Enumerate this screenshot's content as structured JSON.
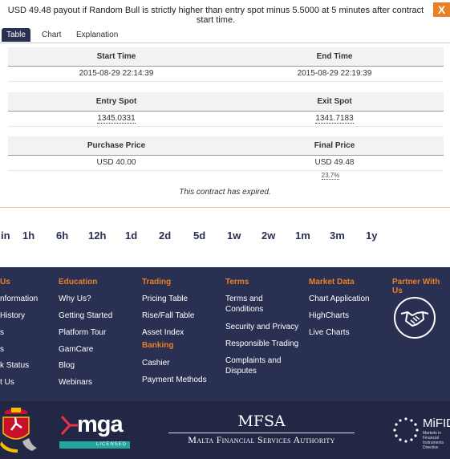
{
  "dialog": {
    "title": "USD 49.48 payout if Random Bull is strictly higher than entry spot minus 5.5000 at 5 minutes after contract start time.",
    "close_label": "X",
    "tabs": [
      "Table",
      "Chart",
      "Explanation"
    ],
    "active_tab": "Table",
    "rows": {
      "start_time_label": "Start Time",
      "start_time_value": "2015-08-29 22:14:39",
      "end_time_label": "End Time",
      "end_time_value": "2015-08-29 22:19:39",
      "entry_spot_label": "Entry Spot",
      "entry_spot_value": "1345.0331",
      "exit_spot_label": "Exit Spot",
      "exit_spot_value": "1341.7183",
      "purchase_price_label": "Purchase Price",
      "purchase_price_value": "USD 40.00",
      "final_price_label": "Final Price",
      "final_price_value": "USD 49.48",
      "profit_percent": "23.7%"
    },
    "expired_message": "This contract has expired.",
    "accent_color": "#e98024",
    "tab_active_color": "#2a3052"
  },
  "timeframes": [
    "in",
    "1h",
    "6h",
    "12h",
    "1d",
    "2d",
    "5d",
    "1w",
    "2w",
    "1m",
    "3m",
    "1y"
  ],
  "footer": {
    "col1": {
      "heading": "Us",
      "links": [
        "nformation",
        "History",
        "s",
        "s",
        "k Status",
        "t Us"
      ]
    },
    "education": {
      "heading": "Education",
      "links": [
        "Why Us?",
        "Getting Started",
        "Platform Tour",
        "GamCare",
        "Blog",
        "Webinars"
      ]
    },
    "trading": {
      "heading": "Trading",
      "links": [
        "Pricing Table",
        "Rise/Fall Table",
        "Asset Index"
      ]
    },
    "banking": {
      "heading": "Banking",
      "links": [
        "Cashier",
        "Payment Methods"
      ]
    },
    "terms": {
      "heading": "Terms",
      "links": [
        "Terms and Conditions",
        "Security and Privacy",
        "Responsible Trading",
        "Complaints and Disputes"
      ]
    },
    "market_data": {
      "heading": "Market Data",
      "links": [
        "Chart Application",
        "HighCharts",
        "Live Charts"
      ]
    },
    "partner": {
      "heading": "Partner With Us",
      "icon": "handshake-icon"
    },
    "bg_color": "#2a3052",
    "heading_color": "#e98024"
  },
  "regulators": {
    "mga_logo": "mga",
    "mga_badge": "LICENSED",
    "mfsa_logo": "MFSA",
    "mfsa_name": "Malta Financial Services Authority",
    "mifid_logo": "MiFID",
    "mifid_sub": "Markets in Financial Instruments Directive"
  }
}
